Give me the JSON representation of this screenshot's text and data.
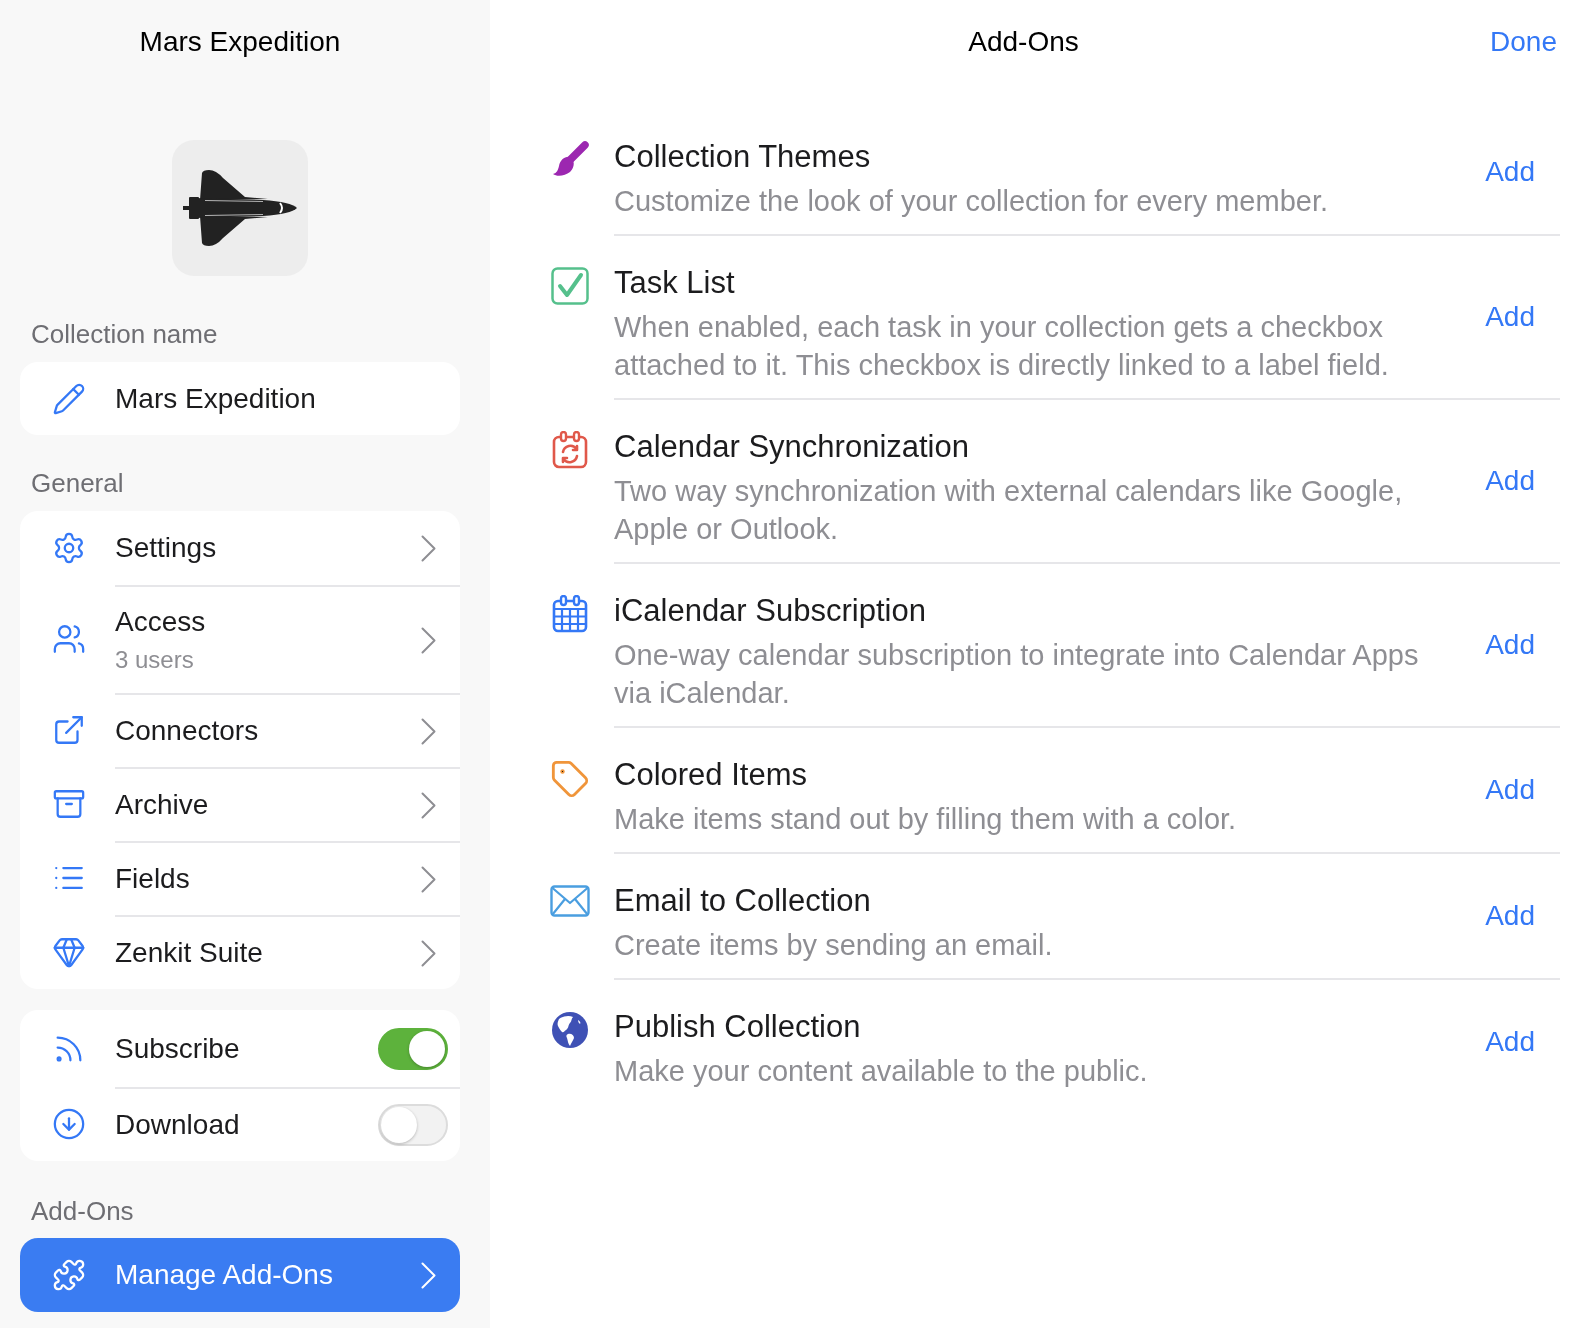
{
  "sidebar": {
    "title": "Mars Expedition",
    "collection_name": {
      "label": "Collection name",
      "value": "Mars Expedition"
    },
    "general": {
      "label": "General",
      "items": [
        {
          "label": "Settings",
          "selected": false
        },
        {
          "label": "Access",
          "subtitle": "3 users",
          "selected": false
        },
        {
          "label": "Connectors",
          "selected": false
        },
        {
          "label": "Archive",
          "selected": false
        },
        {
          "label": "Fields",
          "selected": false
        },
        {
          "label": "Zenkit Suite",
          "selected": false
        }
      ]
    },
    "sync": {
      "items": [
        {
          "label": "Subscribe",
          "on": true
        },
        {
          "label": "Download",
          "on": false
        }
      ]
    },
    "addons": {
      "label": "Add-Ons",
      "items": [
        {
          "label": "Manage Add-Ons",
          "selected": true
        }
      ]
    }
  },
  "main": {
    "title": "Add-Ons",
    "done": "Done",
    "items": [
      {
        "title": "Collection Themes",
        "description": "Customize the look of your collection for every member.",
        "action": "Add"
      },
      {
        "title": "Task List",
        "description": "When enabled, each task in your collection gets a checkbox attached to it. This checkbox is directly linked to a label field.",
        "action": "Add"
      },
      {
        "title": "Calendar Synchronization",
        "description": "Two way synchronization with external calendars like Google, Apple or Outlook.",
        "action": "Add"
      },
      {
        "title": "iCalendar Subscription",
        "description": "One-way calendar subscription to integrate into Calendar Apps via iCalendar.",
        "action": "Add"
      },
      {
        "title": "Colored Items",
        "description": "Make items stand out by filling them with a color.",
        "action": "Add"
      },
      {
        "title": "Email to Collection",
        "description": "Create items by sending an email.",
        "action": "Add"
      },
      {
        "title": "Publish Collection",
        "description": "Make your content available to the public.",
        "action": "Add"
      }
    ]
  }
}
